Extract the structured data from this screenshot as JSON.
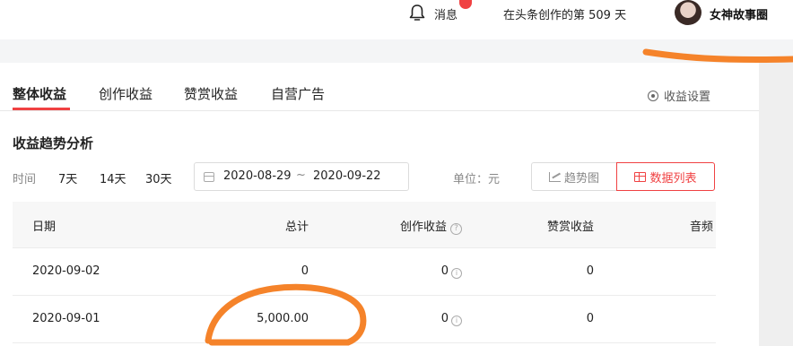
{
  "header": {
    "messages_label": "消息",
    "creation_days_text": "在头条创作的第 509 天",
    "username": "女神故事圈",
    "icons": {
      "bell": "bell-icon",
      "avatar": "avatar"
    },
    "badge_color": "#f04142"
  },
  "tabs": [
    {
      "label": "整体收益",
      "active": true
    },
    {
      "label": "创作收益",
      "active": false
    },
    {
      "label": "赞赏收益",
      "active": false
    },
    {
      "label": "自营广告",
      "active": false
    }
  ],
  "settings_label": "收益设置",
  "section_title": "收益趋势分析",
  "filters": {
    "time_label": "时间",
    "ranges": [
      "7天",
      "14天",
      "30天"
    ],
    "date_start": "2020-08-29",
    "date_sep": "~",
    "date_end": "2020-09-22",
    "unit_label": "单位：元"
  },
  "view_toggle": {
    "trend_label": "趋势图",
    "list_label": "数据列表",
    "active": "list"
  },
  "table": {
    "columns": [
      "日期",
      "总计",
      "创作收益",
      "赞赏收益",
      "音频"
    ],
    "help_mark": "?",
    "info_mark": "i",
    "rows": [
      {
        "date": "2020-09-02",
        "total": "0",
        "creation": "0",
        "reward": "0"
      },
      {
        "date": "2020-09-01",
        "total": "5,000.00",
        "creation": "0",
        "reward": "0"
      }
    ]
  },
  "accent_color": "#f04142",
  "annotation_color": "#f5832a"
}
